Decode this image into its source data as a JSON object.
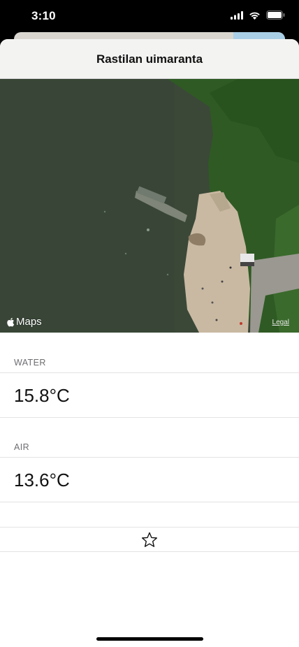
{
  "status_bar": {
    "time": "3:10"
  },
  "nav": {
    "title": "Rastilan uimaranta"
  },
  "map": {
    "logo_text": "Maps",
    "legal_text": "Legal"
  },
  "water": {
    "header": "WATER",
    "temperature": "15.8°C"
  },
  "air": {
    "header": "AIR",
    "temperature": "13.6°C"
  },
  "favorite": {
    "icon": "star-outline-icon"
  },
  "colors": {
    "water": "#3b4838",
    "beach": "#c9b9a2",
    "forest": "#2f5a24",
    "sheet": "#ffffff",
    "nav_bg": "#f3f3f2"
  }
}
